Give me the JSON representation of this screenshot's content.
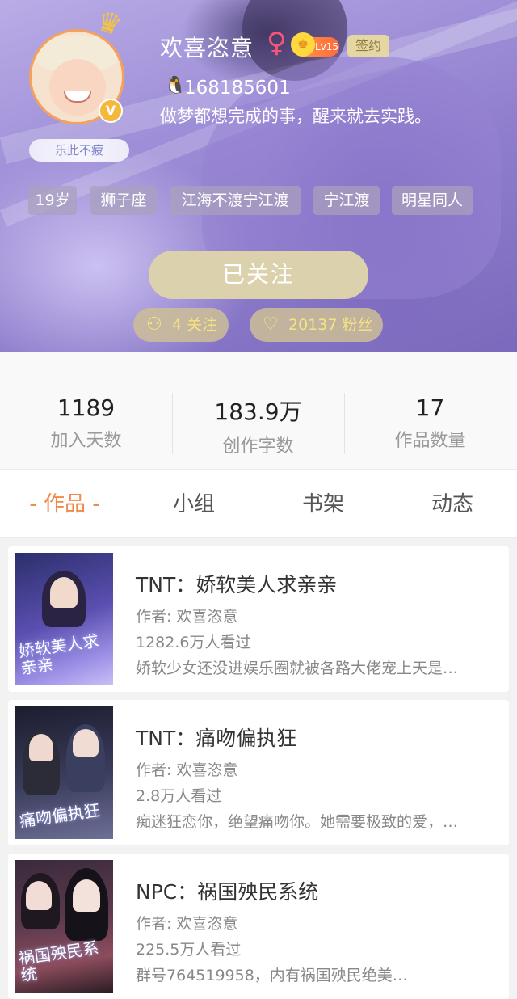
{
  "profile": {
    "username": "欢喜恣意",
    "gender_icon": "female-icon",
    "level": "Lv15",
    "sign_badge": "签约",
    "qq_icon": "penguin-icon",
    "qq_number": "168185601",
    "bio": "做梦都想完成的事，醒来就去实践。",
    "medal": "乐此不疲",
    "verified_mark": "V",
    "tags": [
      "19岁",
      "狮子座",
      "江海不渡宁江渡",
      "宁江渡",
      "明星同人"
    ]
  },
  "actions": {
    "follow_label": "已关注",
    "following_label": "4 关注",
    "fans_label": "20137 粉丝"
  },
  "stats": [
    {
      "value": "1189",
      "label": "加入天数"
    },
    {
      "value": "183.9万",
      "label": "创作字数"
    },
    {
      "value": "17",
      "label": "作品数量"
    }
  ],
  "tabs": {
    "active": "- 作品 -",
    "items": [
      "小组",
      "书架",
      "动态"
    ]
  },
  "books": [
    {
      "title": "TNT：娇软美人求亲亲",
      "author": "作者: 欢喜恣意",
      "views": "1282.6万人看过",
      "desc": "娇软少女还没进娱乐圈就被各路大佬宠上天是…",
      "cover_text": "娇软美人求亲亲"
    },
    {
      "title": "TNT：痛吻偏执狂",
      "author": "作者: 欢喜恣意",
      "views": "2.8万人看过",
      "desc": "痴迷狂恋你，绝望痛吻你。她需要极致的爱，…",
      "cover_text": "痛吻偏执狂"
    },
    {
      "title": "NPC：祸国殃民系统",
      "author": "作者: 欢喜恣意",
      "views": "225.5万人看过",
      "desc": "群号764519958，内有祸国殃民绝美…",
      "cover_text": "祸国殃民系统"
    }
  ],
  "colors": {
    "accent": "#f08a4b",
    "follow_button": "#dcd1ad",
    "pill_text": "#f6e57f",
    "female": "#f4567a"
  }
}
